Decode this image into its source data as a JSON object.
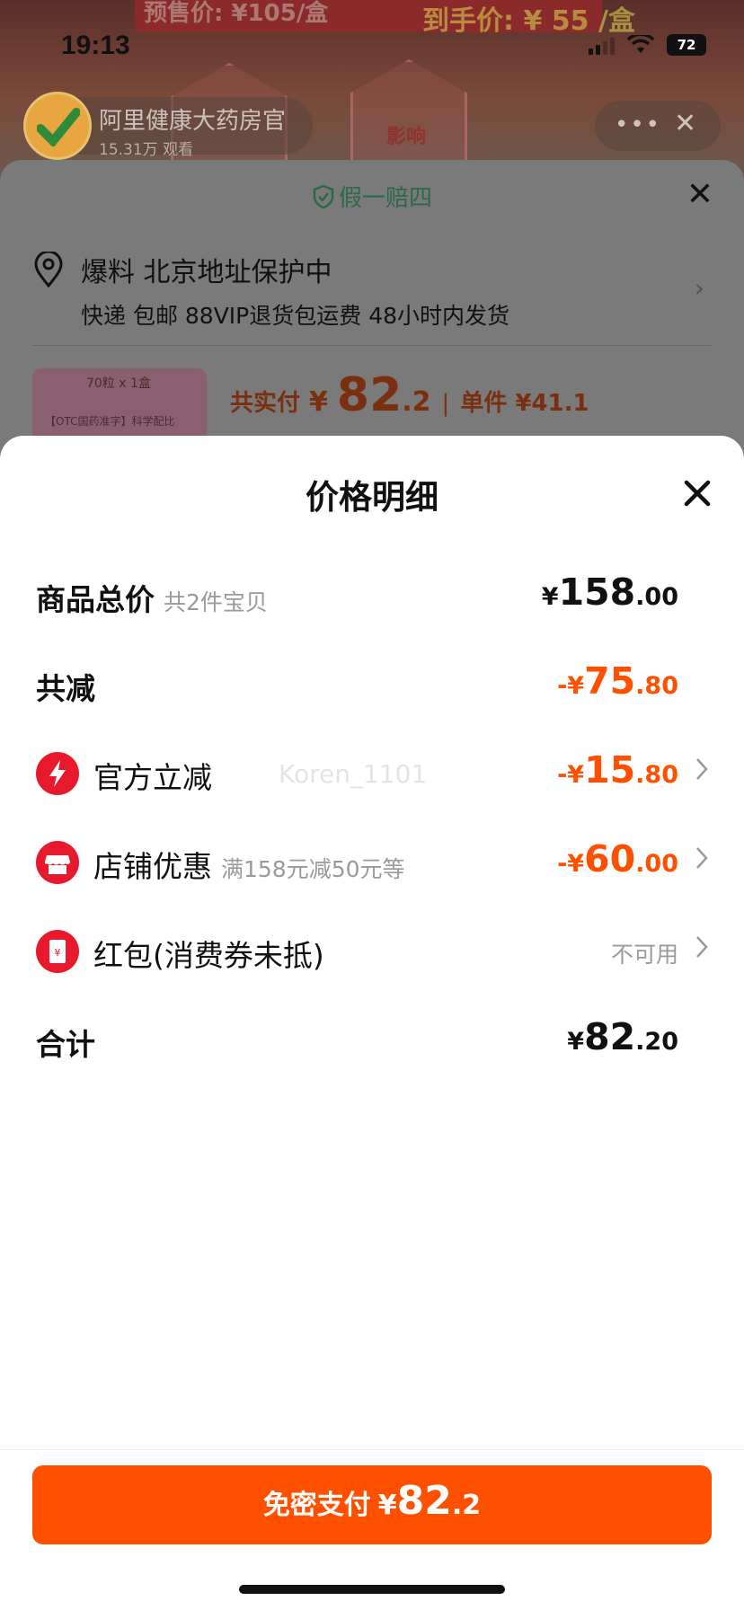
{
  "status_bar": {
    "time": "19:13",
    "battery": "72"
  },
  "background": {
    "banner_left": "预售价: ¥105/盒",
    "banner_right": "到手价: ¥ 55 /盒",
    "hex_text": "影响",
    "live_name": "阿里健康大药房官",
    "live_viewers": "15.31万 观看"
  },
  "order": {
    "guarantee": "假一赔四",
    "address_title": "爆料 北京地址保护中",
    "address_sub": "快递 包邮 88VIP退货包运费 48小时内发货",
    "thumb_top": "70粒 x 1盒",
    "thumb_sub": "【OTC国药准字】科学配比",
    "price_label": "共实付",
    "price_currency": "¥",
    "price_int": "82",
    "price_dec": ".2",
    "unit_price": "单件 ¥41.1"
  },
  "sheet": {
    "title": "价格明细",
    "watermark": "Koren_1101",
    "rows": {
      "subtotal": {
        "label": "商品总价",
        "note": "共2件宝贝",
        "currency": "¥",
        "int": "158",
        "dec": ".00"
      },
      "total_discount": {
        "label": "共减",
        "currency": "-¥",
        "int": "75",
        "dec": ".80"
      },
      "official": {
        "label": "官方立减",
        "currency": "-¥",
        "int": "15",
        "dec": ".80"
      },
      "store": {
        "label": "店铺优惠",
        "note": "满158元减50元等",
        "currency": "-¥",
        "int": "60",
        "dec": ".00"
      },
      "redpacket": {
        "label": "红包(消费券未抵)",
        "value": "不可用"
      },
      "total": {
        "label": "合计",
        "currency": "¥",
        "int": "82",
        "dec": ".20"
      }
    }
  },
  "pay_button": {
    "label": "免密支付",
    "currency": "¥",
    "int": "82",
    "dec": ".2"
  },
  "colors": {
    "accent": "#ff5000",
    "icon_red": "#e8192c",
    "guarantee_green": "#1fa36b"
  }
}
